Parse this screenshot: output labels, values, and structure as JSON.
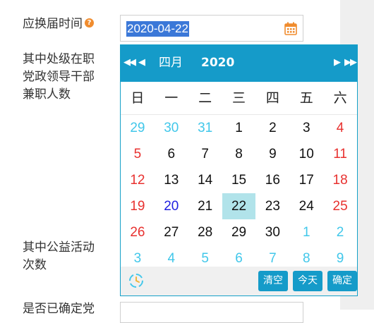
{
  "form": {
    "field1_label": "应换届时间",
    "help_glyph": "?",
    "date_value": "2020-04-22",
    "field2_label": "其中处级在职党政领导干部兼职人数",
    "field3_label": "其中公益活动次数",
    "field4_label": "是否已确定党"
  },
  "picker": {
    "nav": {
      "prev_year": "◀◀",
      "prev_month": "◀",
      "next_month": "▶",
      "next_year": "▶▶"
    },
    "month": "四月",
    "year": "2020",
    "weekdays": [
      "日",
      "一",
      "二",
      "三",
      "四",
      "五",
      "六"
    ],
    "weeks": [
      [
        "29",
        "30",
        "31",
        "1",
        "2",
        "3",
        "4"
      ],
      [
        "5",
        "6",
        "7",
        "8",
        "9",
        "10",
        "11"
      ],
      [
        "12",
        "13",
        "14",
        "15",
        "16",
        "17",
        "18"
      ],
      [
        "19",
        "20",
        "21",
        "22",
        "23",
        "24",
        "25"
      ],
      [
        "26",
        "27",
        "28",
        "29",
        "30",
        "1",
        "2"
      ],
      [
        "3",
        "4",
        "5",
        "6",
        "7",
        "8",
        "9"
      ]
    ],
    "selected_day": "22",
    "today_day": "20",
    "buttons": {
      "clear": "清空",
      "today": "今天",
      "confirm": "确定"
    },
    "colors": {
      "header": "#159bc9",
      "other_month": "#41c7ea",
      "weekend": "#e8312f",
      "selected_bg": "#b1e3ea",
      "today": "#1f1fe0"
    }
  }
}
